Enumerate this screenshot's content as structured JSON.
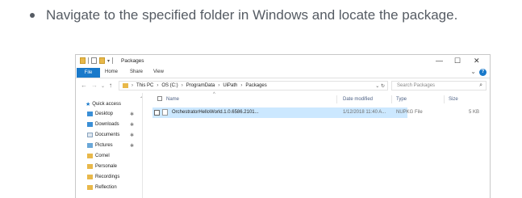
{
  "instruction": {
    "text": "Navigate to the specified folder in Windows and locate the package."
  },
  "window": {
    "title": "Packages",
    "minimize": "—",
    "maximize": "☐",
    "close": "✕"
  },
  "ribbon": {
    "tabs": [
      "File",
      "Home",
      "Share",
      "View"
    ]
  },
  "address": {
    "crumbs": [
      "This PC",
      "OS (C:)",
      "ProgramData",
      "UiPath",
      "Packages"
    ],
    "search_placeholder": "Search Packages"
  },
  "nav_pane": {
    "items": [
      {
        "label": "Quick access",
        "icon": "star-icon",
        "pinned": false
      },
      {
        "label": "Desktop",
        "icon": "desktop-folder-icon",
        "pinned": true
      },
      {
        "label": "Downloads",
        "icon": "downloads-folder-icon",
        "pinned": true
      },
      {
        "label": "Documents",
        "icon": "documents-folder-icon",
        "pinned": true
      },
      {
        "label": "Pictures",
        "icon": "pictures-folder-icon",
        "pinned": true
      },
      {
        "label": "Cornel",
        "icon": "folder-icon",
        "pinned": false
      },
      {
        "label": "Personale",
        "icon": "folder-icon",
        "pinned": false
      },
      {
        "label": "Recordings",
        "icon": "folder-icon",
        "pinned": false
      },
      {
        "label": "Reflection",
        "icon": "folder-icon",
        "pinned": false
      }
    ]
  },
  "file_list": {
    "columns": [
      "Name",
      "Date modified",
      "Type",
      "Size"
    ],
    "rows": [
      {
        "name": "OrchestratorHelloWorld.1.0.6586.2101...",
        "date": "1/12/2018 11:40 A...",
        "type": "NUPKG File",
        "size": "5 KB"
      }
    ]
  },
  "colors": {
    "accent": "#1979ca",
    "selection": "#cce8ff",
    "folder": "#e8b84a"
  }
}
